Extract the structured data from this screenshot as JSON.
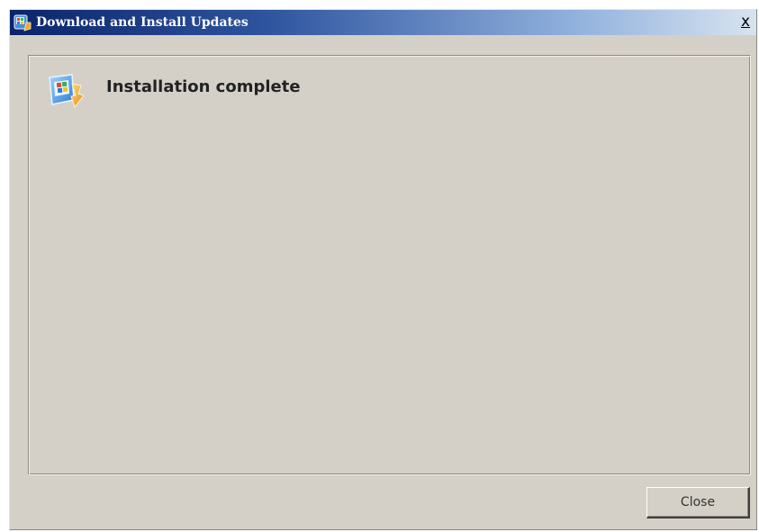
{
  "window": {
    "title": "Download and Install Updates",
    "close_glyph": "x"
  },
  "status": {
    "heading": "Installation complete",
    "icon": "windows-update-icon"
  },
  "footer": {
    "close_label": "Close"
  },
  "colors": {
    "titlebar_start": "#0a246a",
    "titlebar_end": "#d8e3f0",
    "dialog_background": "#d4d0c8"
  }
}
